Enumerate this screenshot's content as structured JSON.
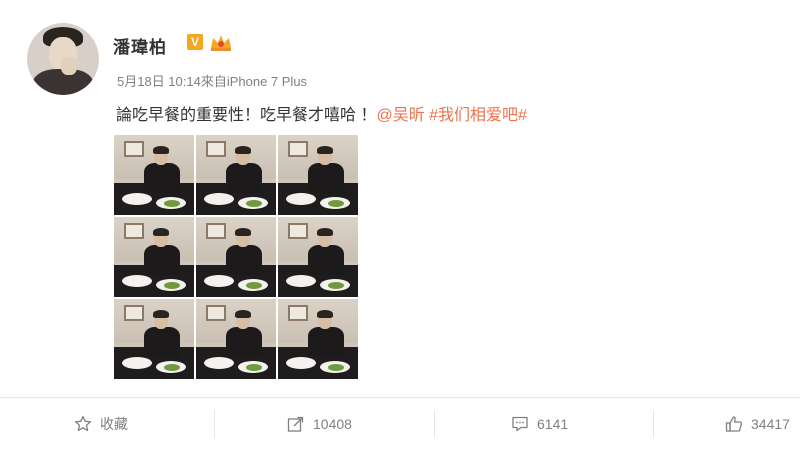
{
  "post": {
    "username": "潘瑋柏",
    "vip_badge": "V",
    "meta": "5月18日 10:14來自iPhone 7 Plus",
    "text_main": "論吃早餐的重要性！吃早餐才嘻哈 ！",
    "mention": "@吴昕",
    "hashtag": "#我们相爱吧#",
    "photo_count": 9
  },
  "actions": {
    "favorite_label": "收藏",
    "repost_count": "10408",
    "comment_count": "6141",
    "like_count": "34417"
  },
  "colors": {
    "link": "#eb7350",
    "vip": "#f5a623",
    "muted": "#808080"
  },
  "icons": {
    "favorite": "star-icon",
    "repost": "share-icon",
    "comment": "comment-icon",
    "like": "thumbs-up-icon"
  }
}
